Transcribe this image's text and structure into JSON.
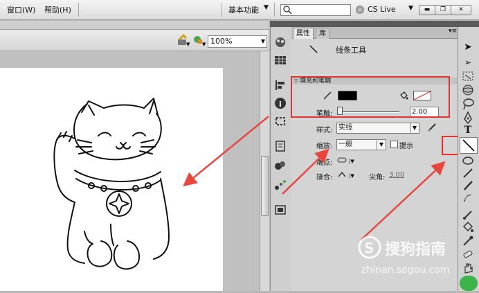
{
  "menu": {
    "window_label": "窗口(W)",
    "help_label": "帮助(H)",
    "workspace_label": "基本功能",
    "cs_live_label": "CS Live"
  },
  "stage": {
    "zoom_value": "100%"
  },
  "panel": {
    "tab_properties": "属性",
    "tab_library": "库",
    "tool_name": "线条工具",
    "section_fill_stroke": "填充和笔触",
    "stroke_label": "笔触:",
    "stroke_value": "2.00",
    "style_label": "样式:",
    "style_value": "实线",
    "scale_label": "缩放:",
    "scale_value": "一般",
    "hint_label": "提示",
    "cap_label": "端点:",
    "join_label": "接合:",
    "miter_label": "尖角:",
    "miter_value": "3.00",
    "stroke_color": "#000000"
  },
  "watermark": {
    "title": "搜狗指南",
    "url": "zhinan.sogou.com"
  },
  "colors": {
    "highlight": "#e6322e",
    "arrow": "#e8463f"
  }
}
